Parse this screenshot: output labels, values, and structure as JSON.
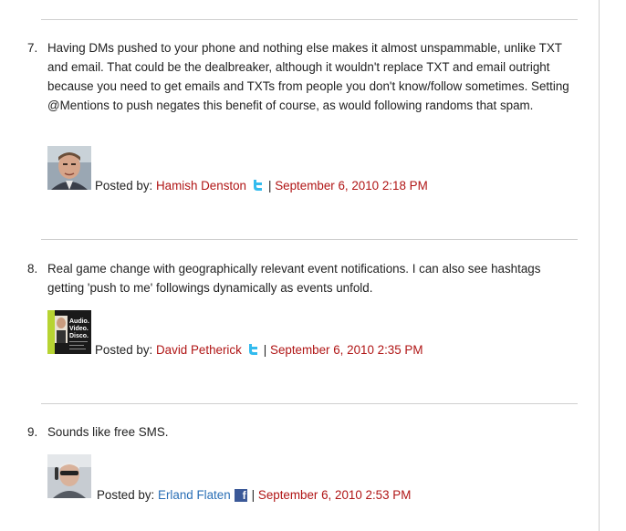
{
  "comments": [
    {
      "number": "7.",
      "text": "Having DMs pushed to your phone and nothing else makes it almost unspammable, unlike TXT and email. That could be the dealbreaker, although it wouldn't replace TXT and email outright because you need to get emails and TXTs from people you don't know/follow sometimes. Setting @Mentions to push negates this benefit of course, as would following randoms that spam.",
      "posted_by": "Posted by:",
      "author": "Hamish Denston",
      "service_icon": "twitter-icon",
      "separator": "|",
      "date": "September 6, 2010 2:18 PM"
    },
    {
      "number": "8.",
      "text": "Real game change with geographically relevant event notifications. I can also see hashtags getting 'push to me' followings dynamically as events unfold.",
      "posted_by": "Posted by:",
      "author": "David Petherick",
      "service_icon": "twitter-icon",
      "separator": "|",
      "date": "September 6, 2010 2:35 PM",
      "avatar_text": "Audio. Video. Disco."
    },
    {
      "number": "9.",
      "text": "Sounds like free SMS.",
      "posted_by": "Posted by:",
      "author": "Erland Flaten",
      "service_icon": "facebook-icon",
      "service_icon_glyph": "f",
      "separator": "|",
      "date": "September 6, 2010 2:53 PM"
    }
  ],
  "colors": {
    "author_link": "#b01515",
    "facebook_author_link": "#2a6fb6",
    "date_link": "#b01515",
    "divider": "#cfcfcf",
    "twitter_blue": "#33bbee",
    "facebook_blue": "#3b5998"
  }
}
